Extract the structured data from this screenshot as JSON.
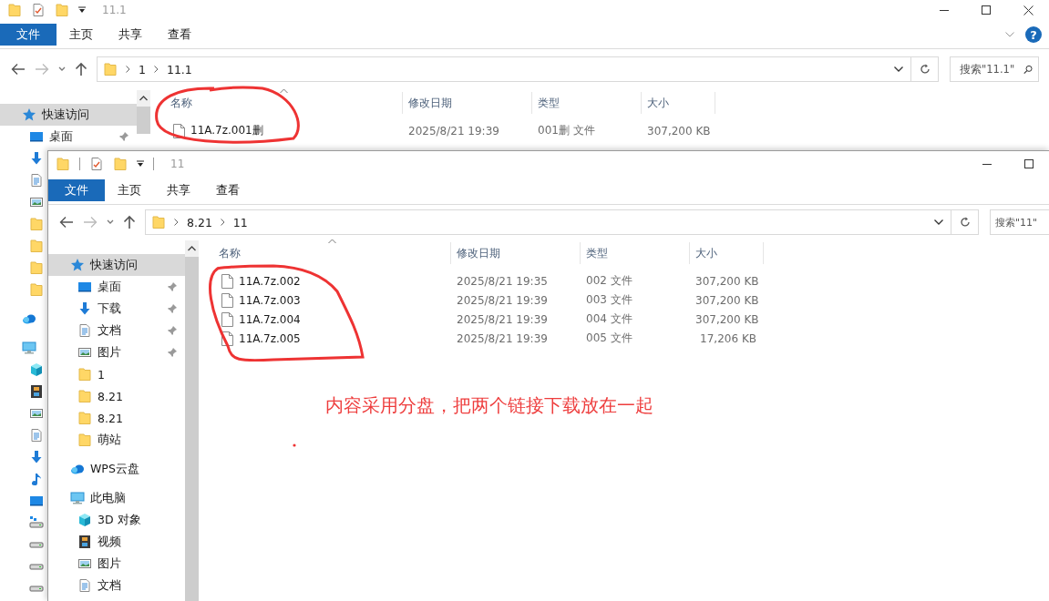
{
  "back_window": {
    "title": "11.1",
    "caption_buttons": [
      {
        "kind": "minimize"
      },
      {
        "kind": "maximize"
      },
      {
        "kind": "close"
      }
    ],
    "ribbon_tabs": [
      {
        "label": "文件",
        "selected": true
      },
      {
        "label": "主页",
        "selected": false
      },
      {
        "label": "共享",
        "selected": false
      },
      {
        "label": "查看",
        "selected": false
      }
    ],
    "help_button": "?",
    "address": [
      "1",
      "11.1"
    ],
    "search": {
      "placeholder": "搜索\"11.1\""
    },
    "nav": [
      {
        "kind": "quick-access",
        "label": "快速访问",
        "selected": true,
        "children": [
          {
            "kind": "desktop",
            "label": "桌面",
            "selected": false,
            "pinned": true
          },
          {
            "kind": "download"
          },
          {
            "kind": "documents"
          },
          {
            "kind": "pictures"
          },
          {
            "kind": "folder"
          },
          {
            "kind": "folder"
          },
          {
            "kind": "folder"
          },
          {
            "kind": "folder"
          }
        ]
      },
      {
        "kind": "cloud"
      },
      {
        "kind": "computer",
        "children": [
          {
            "kind": "objects"
          },
          {
            "kind": "videos"
          },
          {
            "kind": "pictures"
          },
          {
            "kind": "documents"
          },
          {
            "kind": "download"
          },
          {
            "kind": "music"
          },
          {
            "kind": "desktop"
          },
          {
            "kind": "network-drive"
          },
          {
            "kind": "drive"
          },
          {
            "kind": "drive"
          },
          {
            "kind": "drive"
          }
        ]
      }
    ],
    "columns": [
      "名称",
      "修改日期",
      "类型",
      "大小"
    ],
    "files": [
      {
        "name": "11A.7z.001删",
        "modified": "2025/8/21 19:39",
        "type": "001删 文件",
        "size": "307,200 KB"
      }
    ]
  },
  "front_window": {
    "title": "11",
    "caption_buttons": [
      {
        "kind": "minimize"
      },
      {
        "kind": "maximize"
      }
    ],
    "ribbon_tabs": [
      {
        "label": "文件",
        "selected": true
      },
      {
        "label": "主页",
        "selected": false
      },
      {
        "label": "共享",
        "selected": false
      },
      {
        "label": "查看",
        "selected": false
      }
    ],
    "address": [
      "8.21",
      "11"
    ],
    "search": {
      "placeholder": "搜索\"11\""
    },
    "nav": [
      {
        "kind": "quick-access",
        "label": "快速访问",
        "selected": true,
        "children": [
          {
            "kind": "desktop",
            "label": "桌面",
            "selected": false,
            "pinned": true
          },
          {
            "kind": "download",
            "label": "下载",
            "selected": false,
            "pinned": true
          },
          {
            "kind": "documents",
            "label": "文档",
            "selected": false,
            "pinned": true
          },
          {
            "kind": "pictures",
            "label": "图片",
            "selected": false,
            "pinned": true
          },
          {
            "kind": "folder",
            "label": "1",
            "selected": false,
            "pinned": false
          },
          {
            "kind": "folder",
            "label": "8.21",
            "selected": false,
            "pinned": false
          },
          {
            "kind": "folder",
            "label": "8.21",
            "selected": false,
            "pinned": false
          },
          {
            "kind": "folder",
            "label": "萌站",
            "selected": false,
            "pinned": false
          }
        ]
      },
      {
        "kind": "cloud",
        "label": "WPS云盘",
        "selected": false
      },
      {
        "kind": "computer",
        "label": "此电脑",
        "selected": false,
        "children": [
          {
            "kind": "objects",
            "label": "3D 对象",
            "selected": false
          },
          {
            "kind": "videos",
            "label": "视频",
            "selected": false
          },
          {
            "kind": "pictures",
            "label": "图片",
            "selected": false
          },
          {
            "kind": "documents",
            "label": "文档",
            "selected": false
          }
        ]
      }
    ],
    "columns": [
      "名称",
      "修改日期",
      "类型",
      "大小"
    ],
    "files": [
      {
        "name": "11A.7z.002",
        "modified": "2025/8/21 19:35",
        "type": "002 文件",
        "size": "307,200 KB"
      },
      {
        "name": "11A.7z.003",
        "modified": "2025/8/21 19:39",
        "type": "003 文件",
        "size": "307,200 KB"
      },
      {
        "name": "11A.7z.004",
        "modified": "2025/8/21 19:39",
        "type": "004 文件",
        "size": "307,200 KB"
      },
      {
        "name": "11A.7z.005",
        "modified": "2025/8/21 19:39",
        "type": "005 文件",
        "size": "17,206 KB"
      }
    ]
  },
  "annotation": {
    "note": "内容采用分盘，把两个链接下载放在一起"
  }
}
